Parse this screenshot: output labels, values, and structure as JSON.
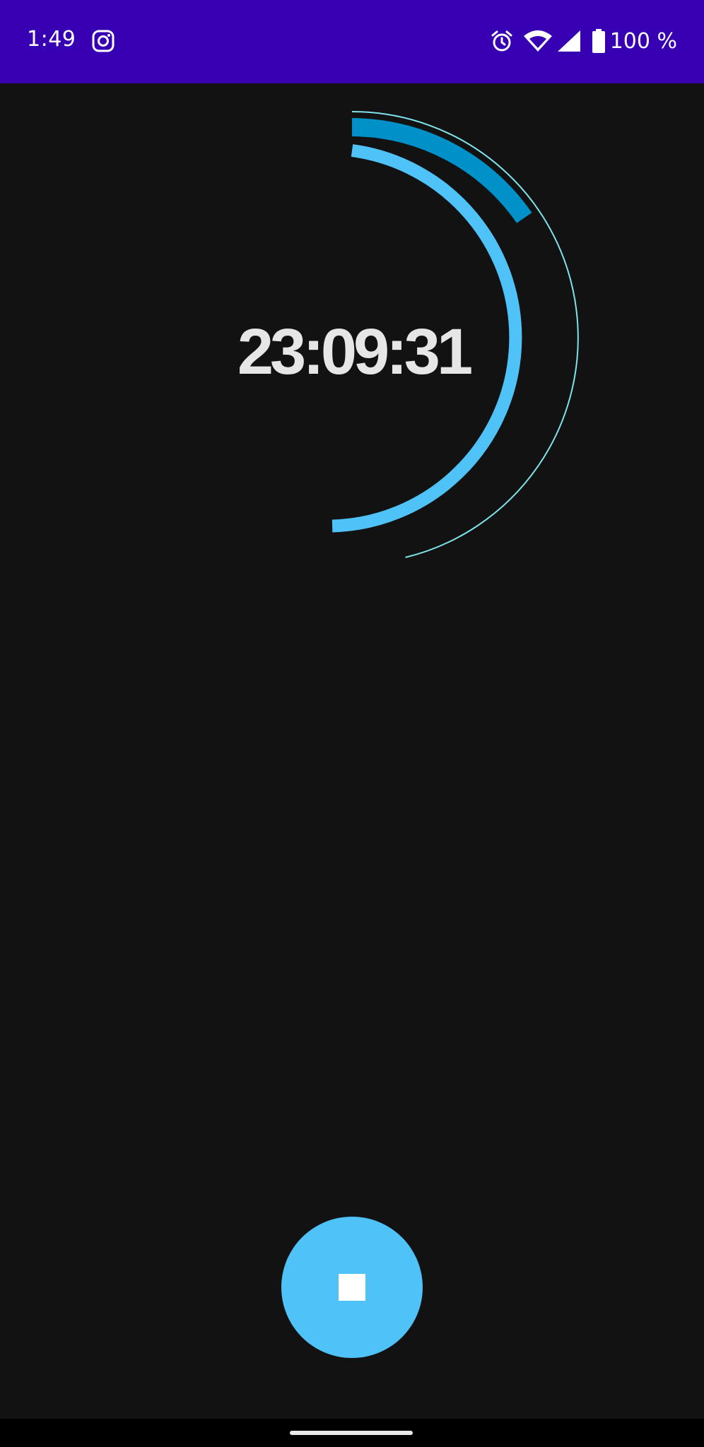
{
  "status_bar": {
    "time": "1:49",
    "left_icon": "instagram-icon",
    "right_icons": [
      "alarm-icon",
      "wifi-icon",
      "signal-icon",
      "battery-icon"
    ],
    "battery": "100 %",
    "background_color": "#3700b3"
  },
  "timer": {
    "display": "23:09:31",
    "ring_colors": {
      "outer_thin": "#7fe3ec",
      "dark_arc": "#0091c9",
      "light_arc": "#4fc3f7"
    }
  },
  "controls": {
    "stop_icon": "stop-icon",
    "stop_button_color": "#4fc3f7"
  },
  "nav_bar": {
    "home_indicator": "home-indicator"
  }
}
